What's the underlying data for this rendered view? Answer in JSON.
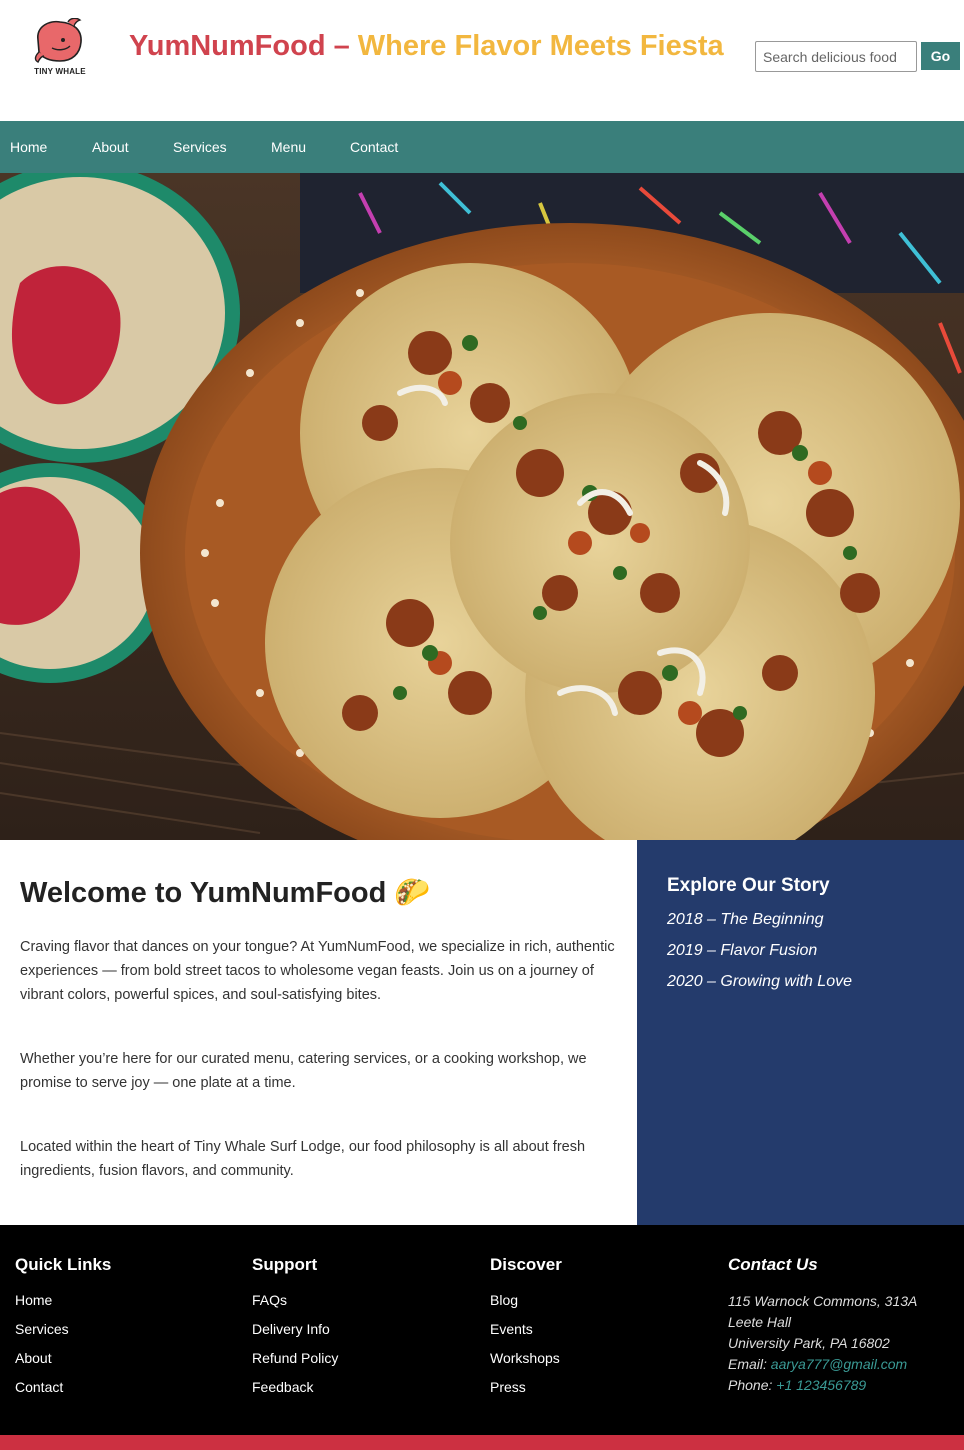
{
  "header": {
    "logo_text": "TINY WHALE",
    "title_part1": "YumNumFood –",
    "title_part2": "Where Flavor Meets Fiesta",
    "search_placeholder": "Search delicious food",
    "search_button": "Go"
  },
  "nav": {
    "items": [
      "Home",
      "About",
      "Services",
      "Menu",
      "Contact"
    ]
  },
  "main": {
    "heading": "Welcome to YumNumFood 🌮",
    "paragraphs": [
      "Craving flavor that dances on your tongue? At YumNumFood, we specialize in rich, authentic experiences — from bold street tacos to wholesome vegan feasts. Join us on a journey of vibrant colors, powerful spices, and soul-satisfying bites.",
      "Whether you’re here for our curated menu, catering services, or a cooking workshop, we promise to serve joy — one plate at a time.",
      "Located within the heart of Tiny Whale Surf Lodge, our food philosophy is all about fresh ingredients, fusion flavors, and community."
    ]
  },
  "sidebar": {
    "heading": "Explore Our Story",
    "items": [
      "2018 – The Beginning",
      "2019 – Flavor Fusion",
      "2020 – Growing with Love"
    ]
  },
  "footer": {
    "quick_links": {
      "heading": "Quick Links",
      "items": [
        "Home",
        "Services",
        "About",
        "Contact"
      ]
    },
    "support": {
      "heading": "Support",
      "items": [
        "FAQs",
        "Delivery Info",
        "Refund Policy",
        "Feedback"
      ]
    },
    "discover": {
      "heading": "Discover",
      "items": [
        "Blog",
        "Events",
        "Workshops",
        "Press"
      ]
    },
    "contact": {
      "heading": "Contact Us",
      "address1": "115 Warnock Commons, 313A",
      "address2": "Leete Hall",
      "address3": "University Park, PA 16802",
      "email_label": "Email:",
      "email": "aarya777@gmail.com",
      "phone_label": "Phone:",
      "phone": "+1 123456789"
    }
  },
  "colors": {
    "brand_red": "#d0434e",
    "brand_yellow": "#f2b73f",
    "teal": "#3a7f7b",
    "navy": "#243b6c",
    "footer_bar": "#cc3041"
  }
}
